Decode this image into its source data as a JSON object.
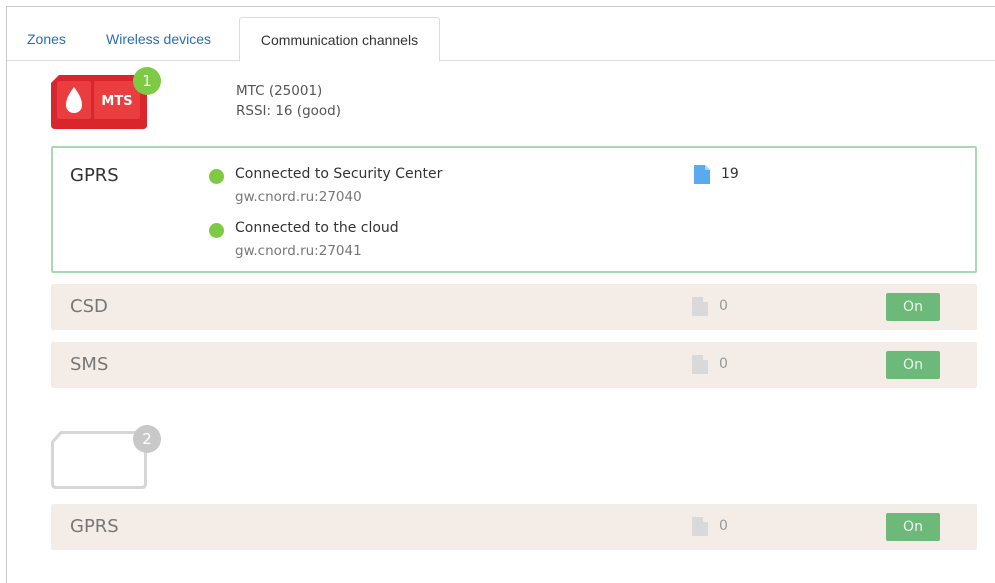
{
  "tabs": [
    {
      "label": "Zones"
    },
    {
      "label": "Wireless devices"
    },
    {
      "label": "Communication channels"
    }
  ],
  "sim1": {
    "badge": "1",
    "operator_logo": "MTS",
    "operator": "MTC (25001)",
    "rssi": "RSSI: 16 (good)",
    "colors": {
      "logo": "#d9262c",
      "badge": "#7fca45"
    }
  },
  "sim2": {
    "badge": "2",
    "colors": {
      "badge": "#c8c8c8"
    }
  },
  "channels": [
    {
      "name": "GPRS",
      "statuses": [
        {
          "title": "Connected to Security Center",
          "address": "gw.cnord.ru:27040"
        },
        {
          "title": "Connected to the cloud",
          "address": "gw.cnord.ru:27041"
        }
      ],
      "count": "19",
      "count_icon": "document-icon"
    },
    {
      "name": "CSD",
      "count": "0",
      "count_icon": "document-icon",
      "toggle": "On"
    },
    {
      "name": "SMS",
      "count": "0",
      "count_icon": "document-icon",
      "toggle": "On"
    }
  ],
  "sim2_channels": [
    {
      "name": "GPRS",
      "count": "0",
      "count_icon": "document-icon",
      "toggle": "On"
    }
  ],
  "colors": {
    "accent_green": "#7fca45",
    "toggle_on": "#6cb979",
    "row_bg": "#f4ede7",
    "active_border": "#a8d9b0",
    "link": "#2a6db3"
  }
}
